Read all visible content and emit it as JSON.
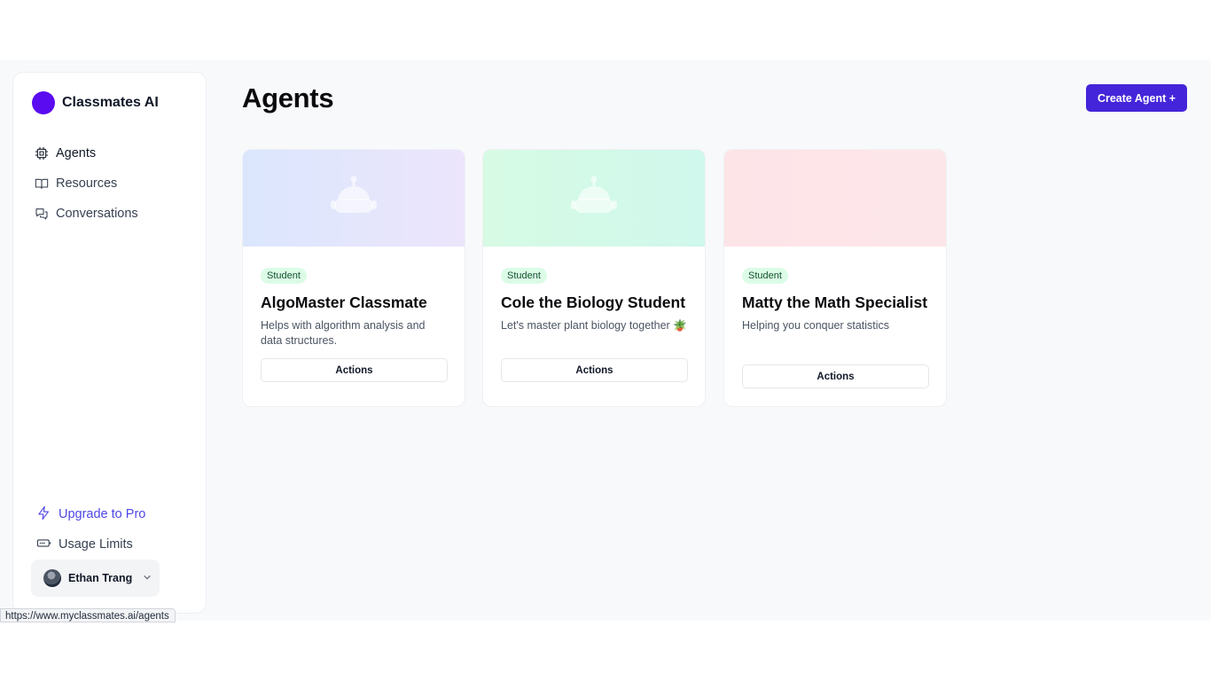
{
  "brand": {
    "name": "Classmates AI",
    "logo_color": "#5a0bf0"
  },
  "nav": {
    "items": [
      {
        "label": "Agents",
        "icon": "cpu-icon",
        "active": true
      },
      {
        "label": "Resources",
        "icon": "book-open-icon",
        "active": false
      },
      {
        "label": "Conversations",
        "icon": "chat-bubbles-icon",
        "active": false
      }
    ]
  },
  "bottom_nav": {
    "upgrade": {
      "label": "Upgrade to Pro",
      "icon": "lightning-icon",
      "color": "#4f46e5"
    },
    "usage": {
      "label": "Usage Limits",
      "icon": "gauge-icon"
    }
  },
  "user": {
    "name": "Ethan Trang"
  },
  "main": {
    "title": "Agents",
    "create_button": {
      "label": "Create Agent +",
      "color": "#4425d9"
    }
  },
  "cards": [
    {
      "badge": "Student",
      "title": "AlgoMaster Classmate",
      "description": "Helps with algorithm analysis and data structures.",
      "action_label": "Actions"
    },
    {
      "badge": "Student",
      "title": "Cole the Biology Student",
      "description": "Let's master plant biology together 🪴",
      "action_label": "Actions"
    },
    {
      "badge": "Student",
      "title": "Matty the Math Specialist",
      "description": "Helping you conquer statistics",
      "action_label": "Actions"
    }
  ],
  "status_bar": {
    "url": "https://www.myclassmates.ai/agents"
  }
}
